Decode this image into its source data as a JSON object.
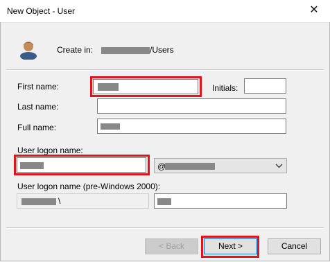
{
  "window": {
    "title": "New Object - User",
    "close_glyph": "✕"
  },
  "header": {
    "create_in_label": "Create in:",
    "create_in_suffix": "/Users"
  },
  "form": {
    "first_name_label": "First name:",
    "initials_label": "Initials:",
    "last_name_label": "Last name:",
    "full_name_label": "Full name:",
    "logon_label": "User logon name:",
    "domain_prefix": "@",
    "pre2000_label": "User logon name (pre-Windows 2000):",
    "pre2000_separator": "\\"
  },
  "buttons": {
    "back": "< Back",
    "next": "Next >",
    "cancel": "Cancel"
  },
  "colors": {
    "highlight": "#e1141b",
    "redaction": "#888888"
  }
}
